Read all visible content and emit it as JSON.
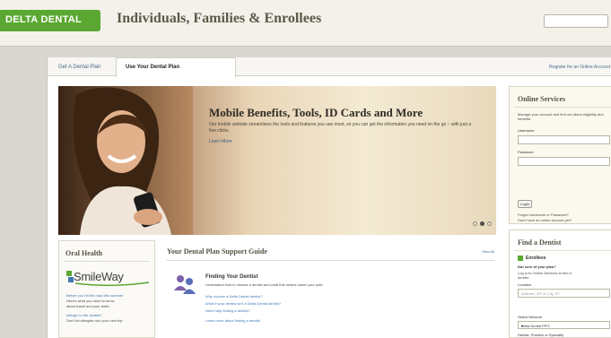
{
  "header": {
    "logo": "DELTA DENTAL",
    "title": "Individuals, Families & Enrollees",
    "brand_color": "#5aa832"
  },
  "tabs": [
    {
      "label": "Get A Dental Plan"
    },
    {
      "label": "Use Your Dental Plan"
    }
  ],
  "register_link": "Register for an Online Account",
  "hero": {
    "title": "Mobile Benefits, Tools, ID Cards and More",
    "description": "Our mobile website streamlines the tools and features you use most, so you can get the information you need on the go – with just a few clicks.",
    "link": "Learn More",
    "slides_total": 3,
    "active_slide": 2
  },
  "oral_health": {
    "title": "Oral Health",
    "logo_text": "SmileWay",
    "lines": [
      "Before you hit the road this summer",
      "Here's what you need to know",
      "about travel and your teeth.",
      "Allergic to the dentist?",
      "Don't let allergies ruin your next trip"
    ]
  },
  "guide": {
    "title": "Your Dental Plan Support Guide",
    "view_all": "View All",
    "subtitle": "Finding Your Dentist",
    "description": "Understand how to choose a dentist and what this means under your plan.",
    "links": [
      "Why choose a Delta Dental dentist?",
      "What if your dentist isn't a Delta Dental dentist?",
      "Need help finding a dentist?",
      "Learn more about finding a dentist"
    ]
  },
  "online_services": {
    "title": "Online Services",
    "description": "Manage your account and find out about eligibility and benefits.",
    "username_label": "Username",
    "password_label": "Password",
    "login_button": "Login",
    "forgot": "Forgot Username or Password?",
    "no_account": "Don't have an online account yet?",
    "register": "Register Today"
  },
  "find_dentist": {
    "title": "Find a Dentist",
    "enrollees": "Enrollees",
    "question": "Not sure of your plan?",
    "login_hint": "Log in to Online Services to find a",
    "login_hint2": "dentist.",
    "location_label": "Location",
    "location_placeholder": "Address, ZIP or City, ST",
    "network_label": "Select Network",
    "network_value": "Delta Dental PPO",
    "dentist_label": "Dentist, Practice or Specialty"
  }
}
